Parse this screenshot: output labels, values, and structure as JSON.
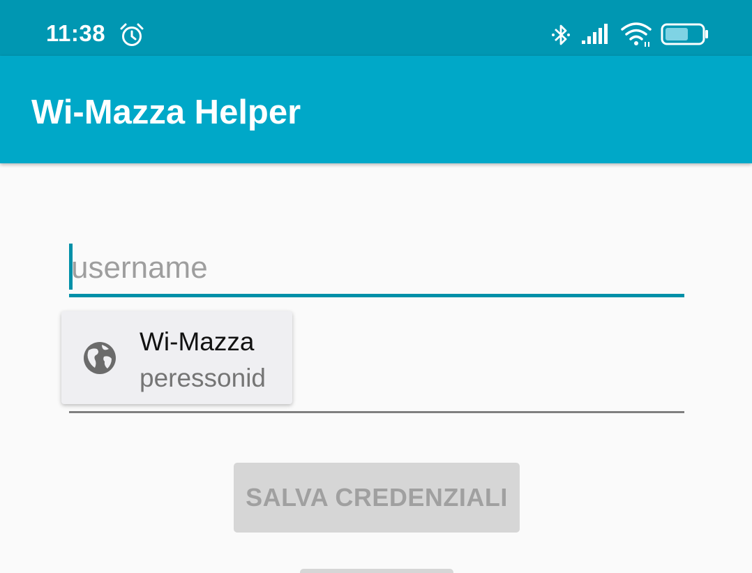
{
  "status_bar": {
    "time": "11:38",
    "icons": [
      "alarm-icon",
      "bluetooth-icon",
      "signal-icon",
      "wifi-icon",
      "battery-icon"
    ],
    "color": "#0097b2"
  },
  "app_bar": {
    "title": "Wi-Mazza Helper",
    "color": "#00a8c8"
  },
  "form": {
    "username_placeholder": "username",
    "username_value": "",
    "save_button_label": "SALVA CREDENZIALI",
    "accent_color": "#0090a8"
  },
  "autofill": {
    "icon": "globe-icon",
    "title": "Wi-Mazza",
    "subtitle": "peressonid"
  }
}
